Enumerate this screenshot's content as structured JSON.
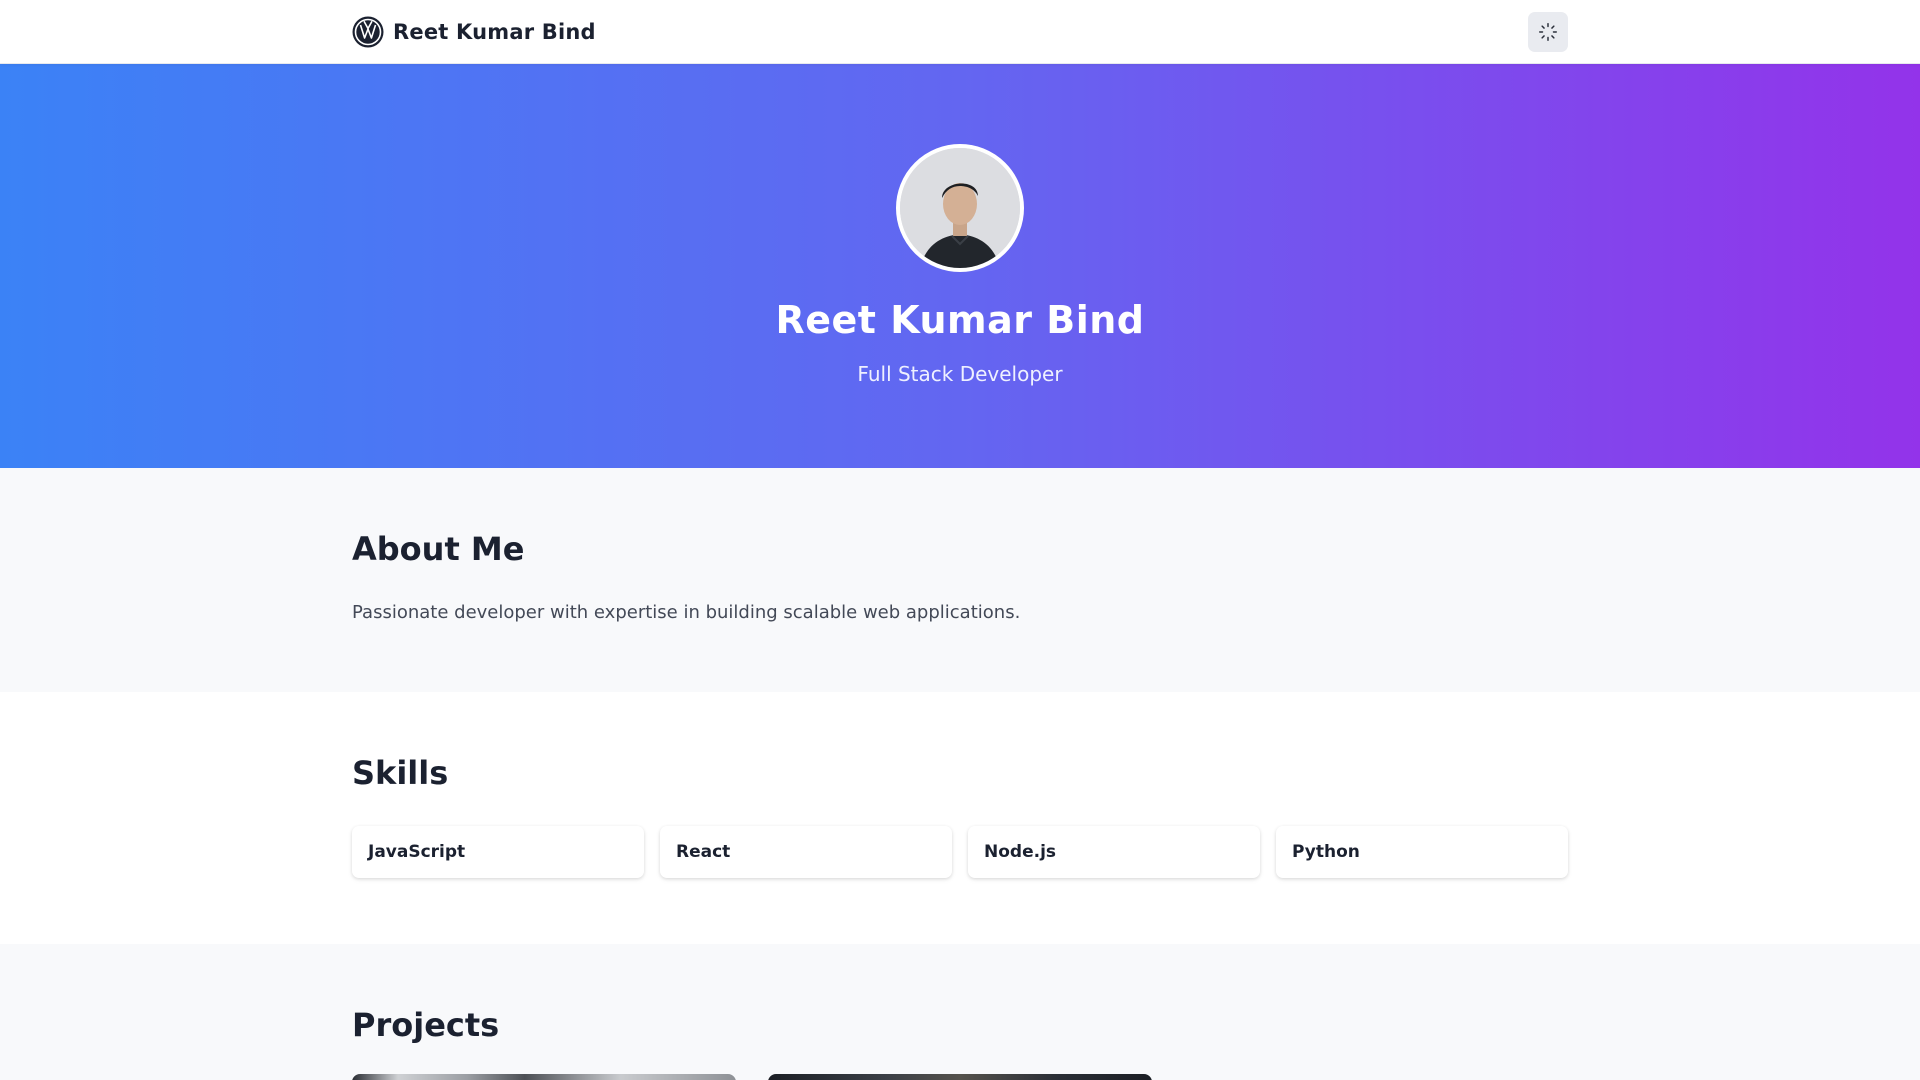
{
  "navbar": {
    "brand_name": "Reet Kumar Bind",
    "brand_logo_icon": "vw-logo-icon",
    "theme_toggle_icon": "loader-icon"
  },
  "hero": {
    "name": "Reet Kumar Bind",
    "role": "Full Stack Developer",
    "gradient": [
      "#3b82f6",
      "#6366f1",
      "#9333ea"
    ]
  },
  "about": {
    "title": "About Me",
    "text": "Passionate developer with expertise in building scalable web applications."
  },
  "skills": {
    "title": "Skills",
    "items": [
      {
        "label": "JavaScript"
      },
      {
        "label": "React"
      },
      {
        "label": "Node.js"
      },
      {
        "label": "Python"
      }
    ]
  },
  "projects": {
    "title": "Projects"
  }
}
